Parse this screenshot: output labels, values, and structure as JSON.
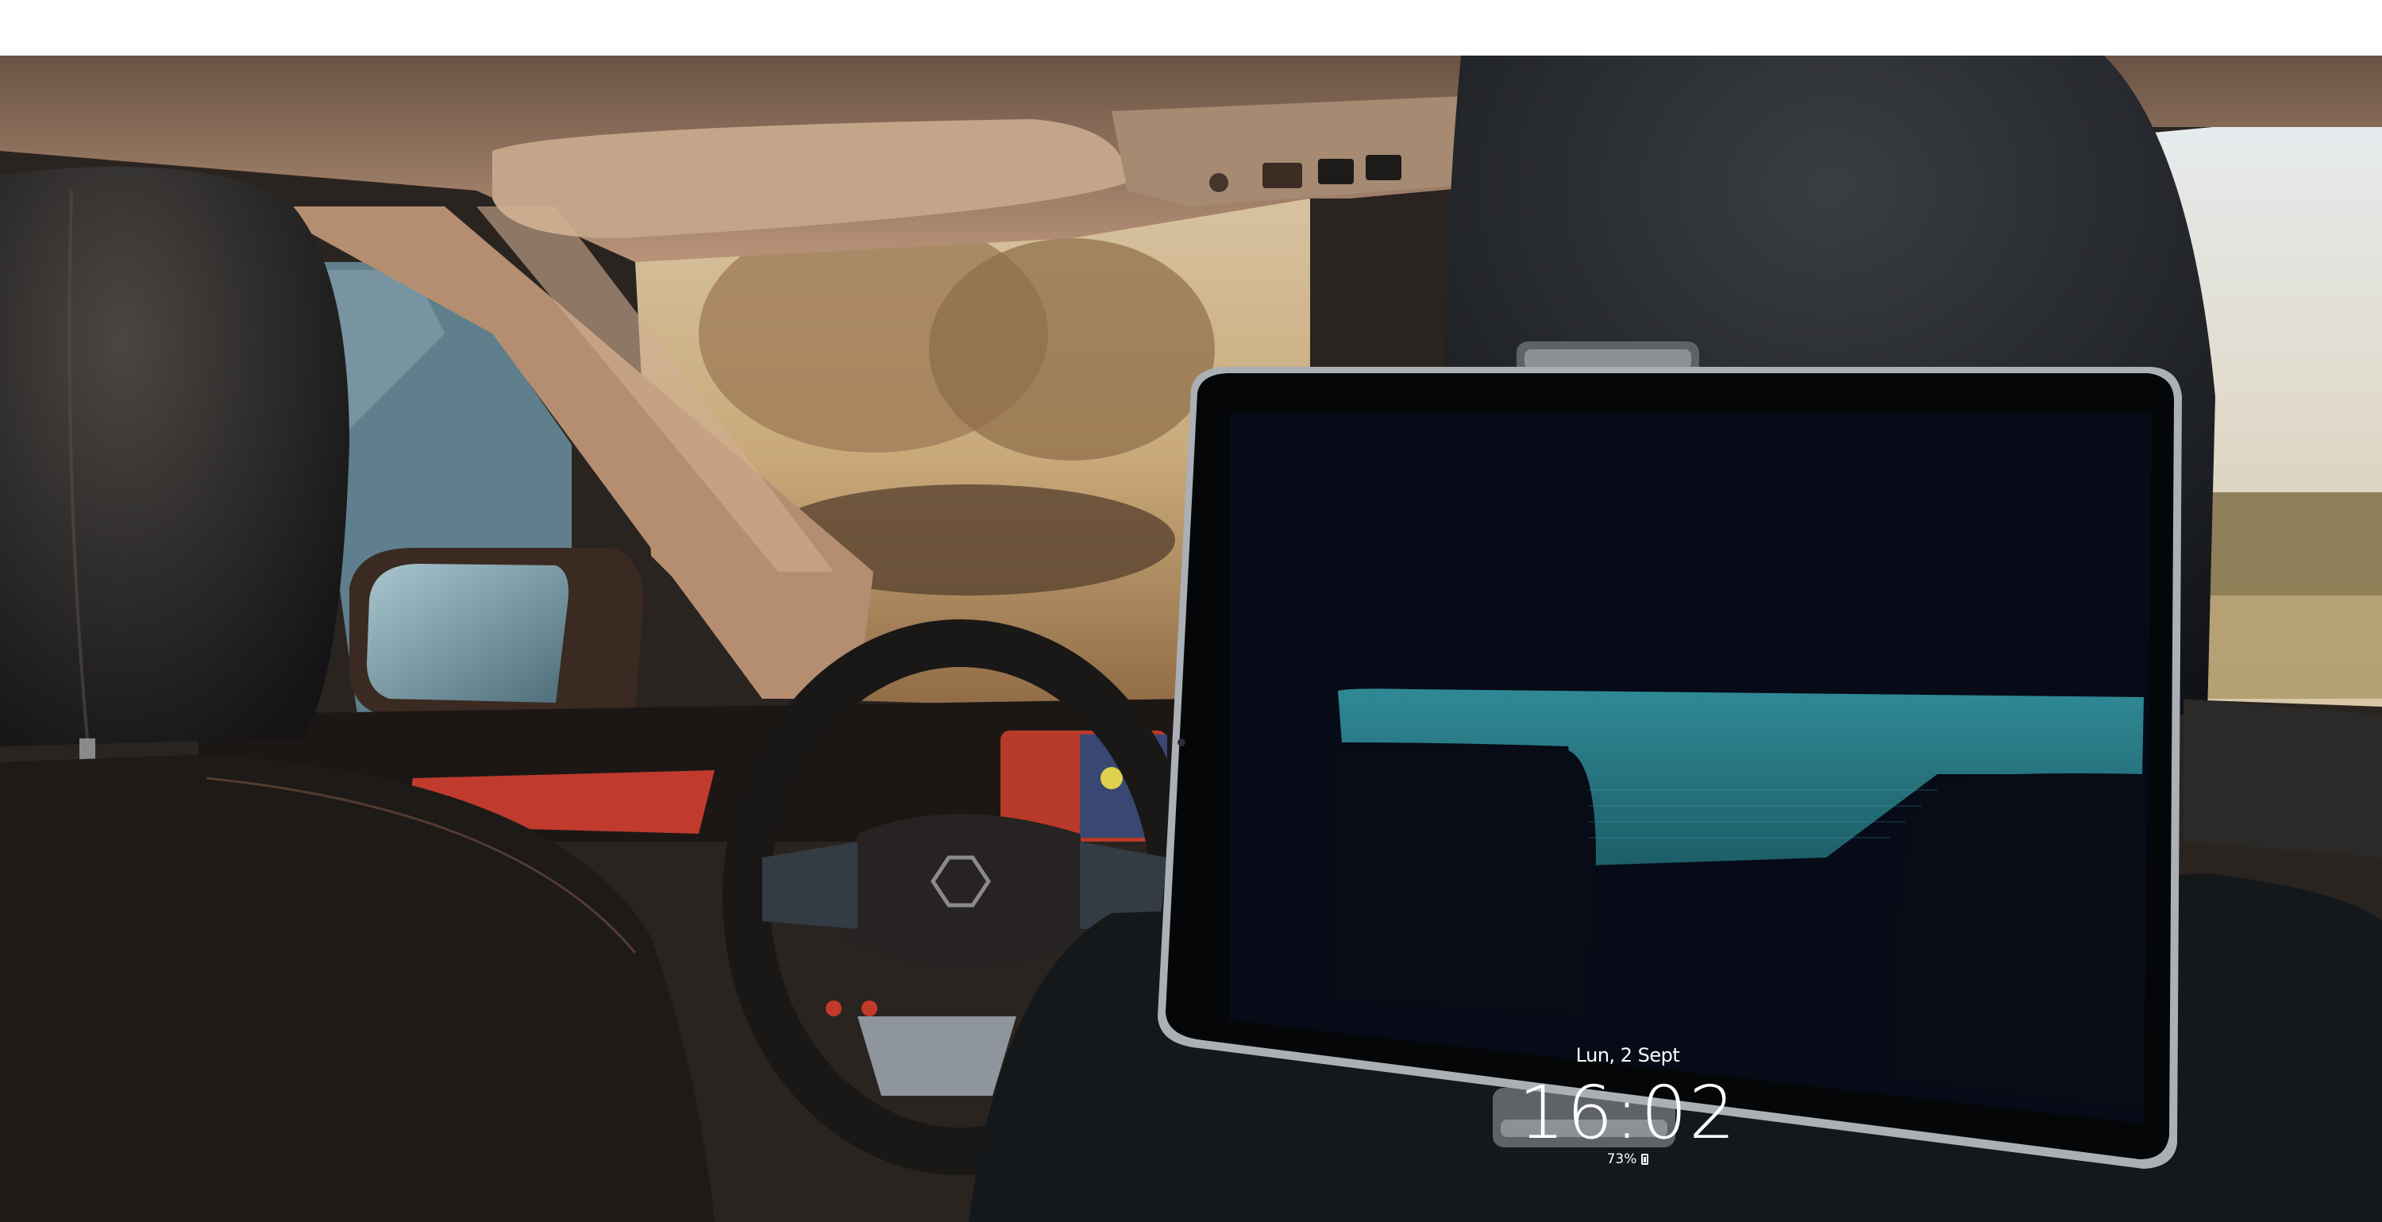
{
  "tablet": {
    "date": "Lun, 2 Sept",
    "time": "16:02",
    "battery": "73%",
    "battery_icon": "battery-icon"
  },
  "colors": {
    "screen_bg": "#060b17",
    "wallpaper_teal": "#2c7f8a",
    "interior_dark": "#1b1e22",
    "sky": "#d9d2c4",
    "trim_red": "#c0392b"
  }
}
